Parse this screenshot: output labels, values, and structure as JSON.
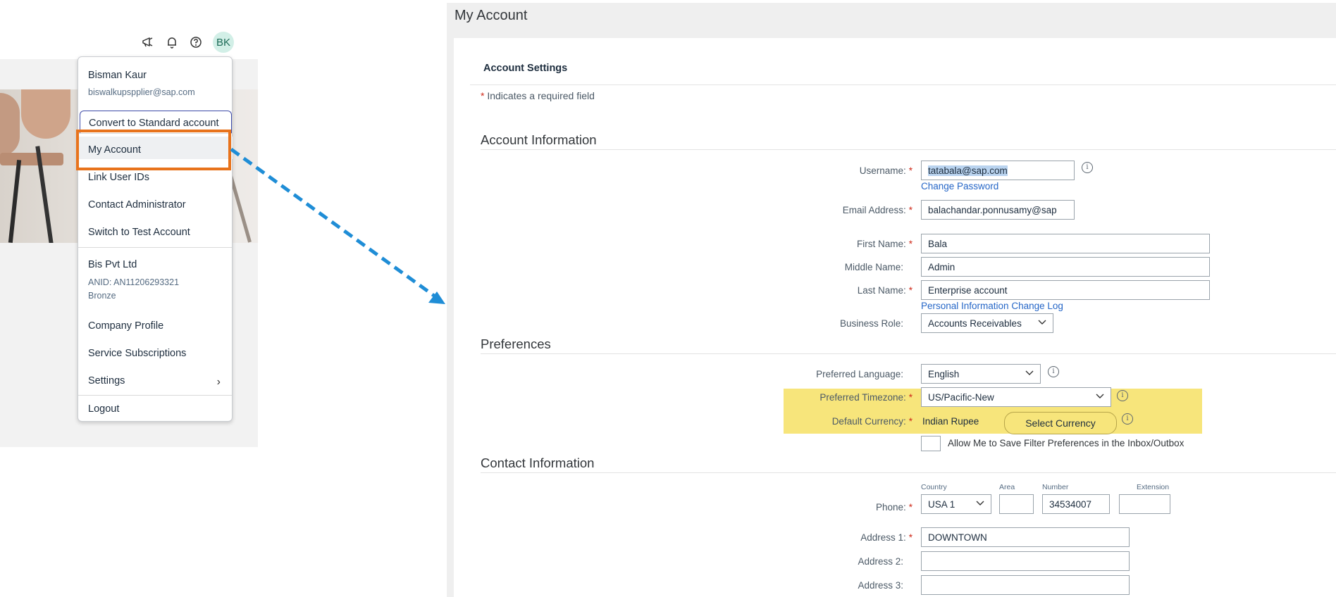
{
  "topbar": {
    "avatar_initials": "BK",
    "icons": [
      "megaphone-icon",
      "bell-icon",
      "help-icon"
    ]
  },
  "menu": {
    "user_name": "Bisman Kaur",
    "user_email": "biswalkupspplier@sap.com",
    "items": [
      "Convert to Standard account",
      "My Account",
      "Link User IDs",
      "Contact Administrator",
      "Switch to Test Account"
    ],
    "company": {
      "name": "Bis Pvt Ltd",
      "anid": "ANID: AN11206293321",
      "tier": "Bronze"
    },
    "company_items": [
      "Company Profile",
      "Service Subscriptions",
      "Settings",
      "Logout"
    ],
    "highlight_color": "#e8731c"
  },
  "page": {
    "title": "My Account",
    "settings_heading": "Account Settings",
    "required_note": "Indicates a required field"
  },
  "account_info": {
    "heading": "Account Information",
    "username_label": "Username:",
    "username_value": "tatabala@sap.com",
    "change_password": "Change Password",
    "email_label": "Email Address:",
    "email_value": "balachandar.ponnusamy@sap",
    "first_name_label": "First Name:",
    "first_name_value": "Bala",
    "middle_name_label": "Middle Name:",
    "middle_name_value": "Admin",
    "last_name_label": "Last Name:",
    "last_name_value": "Enterprise account",
    "change_log": "Personal Information Change Log",
    "business_role_label": "Business Role:",
    "business_role_value": "Accounts Receivables"
  },
  "preferences": {
    "heading": "Preferences",
    "language_label": "Preferred Language:",
    "language_value": "English",
    "timezone_label": "Preferred Timezone:",
    "timezone_value": "US/Pacific-New",
    "currency_label": "Default Currency:",
    "currency_value": "Indian Rupee",
    "select_currency": "Select Currency",
    "filter_pref_label": "Allow Me to Save Filter Preferences in the Inbox/Outbox",
    "highlight_color": "#f7e57b"
  },
  "contact": {
    "heading": "Contact Information",
    "col_country": "Country",
    "col_area": "Area",
    "col_number": "Number",
    "col_extension": "Extension",
    "phone_label": "Phone:",
    "phone_country": "USA 1",
    "phone_area": "",
    "phone_number": "34534007",
    "phone_extension": "",
    "address1_label": "Address 1:",
    "address1_value": "DOWNTOWN",
    "address2_label": "Address 2:",
    "address2_value": "",
    "address3_label": "Address 3:",
    "address3_value": ""
  }
}
